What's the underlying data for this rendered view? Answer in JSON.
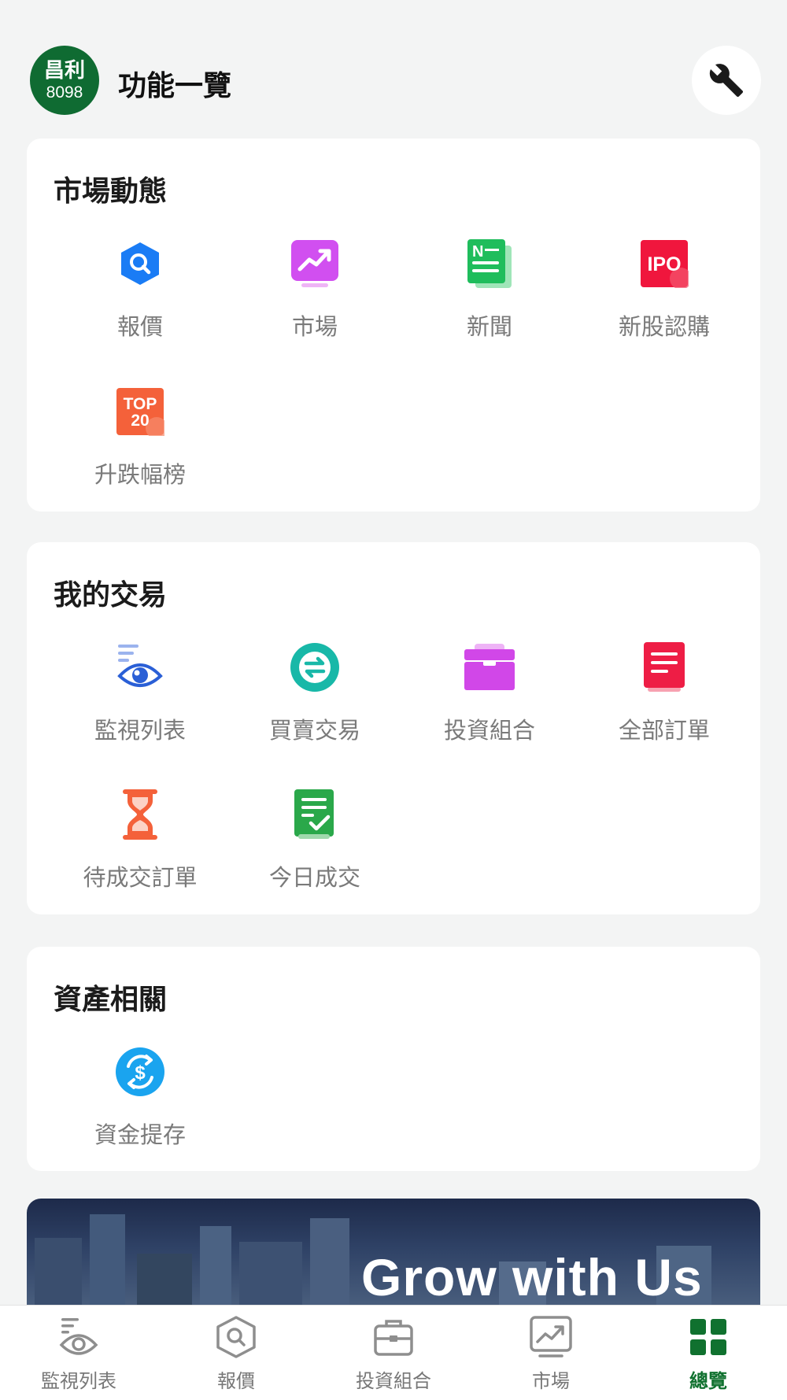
{
  "header": {
    "logo_line1": "昌利",
    "logo_line2": "8098",
    "title": "功能一覽",
    "settings_icon": "wrench-icon"
  },
  "sections": [
    {
      "title": "市場動態",
      "items": [
        {
          "label": "報價",
          "icon": "search-hexagon-icon",
          "color": "#1a7cf5"
        },
        {
          "label": "市場",
          "icon": "trend-chart-icon",
          "color": "#d14ff0"
        },
        {
          "label": "新聞",
          "icon": "newspaper-icon",
          "color": "#1fbd5c"
        },
        {
          "label": "新股認購",
          "icon": "ipo-icon",
          "color": "#f0163d"
        },
        {
          "label": "升跌幅榜",
          "icon": "top20-icon",
          "color": "#f4613a"
        }
      ]
    },
    {
      "title": "我的交易",
      "items": [
        {
          "label": "監視列表",
          "icon": "watchlist-eye-icon",
          "color": "#2a5fd6"
        },
        {
          "label": "買賣交易",
          "icon": "exchange-arrows-icon",
          "color": "#18b8a8"
        },
        {
          "label": "投資組合",
          "icon": "portfolio-box-icon",
          "color": "#d147e8"
        },
        {
          "label": "全部訂單",
          "icon": "order-list-icon",
          "color": "#ee1d45"
        },
        {
          "label": "待成交訂單",
          "icon": "hourglass-icon",
          "color": "#f4613a"
        },
        {
          "label": "今日成交",
          "icon": "checklist-icon",
          "color": "#2aa84a"
        }
      ]
    },
    {
      "title": "資產相關",
      "items": [
        {
          "label": "資金提存",
          "icon": "dollar-transfer-icon",
          "color": "#1aa4ef"
        }
      ]
    }
  ],
  "banner": {
    "text": "Grow with Us"
  },
  "tabbar": [
    {
      "label": "監視列表",
      "icon": "watchlist-eye-icon",
      "active": false
    },
    {
      "label": "報價",
      "icon": "search-hexagon-icon",
      "active": false
    },
    {
      "label": "投資組合",
      "icon": "briefcase-icon",
      "active": false
    },
    {
      "label": "市場",
      "icon": "trend-chart-icon",
      "active": false
    },
    {
      "label": "總覽",
      "icon": "grid-icon",
      "active": true
    }
  ],
  "colors": {
    "brand": "#0f6b32",
    "active_tab": "#10712f",
    "background": "#f3f4f4"
  }
}
